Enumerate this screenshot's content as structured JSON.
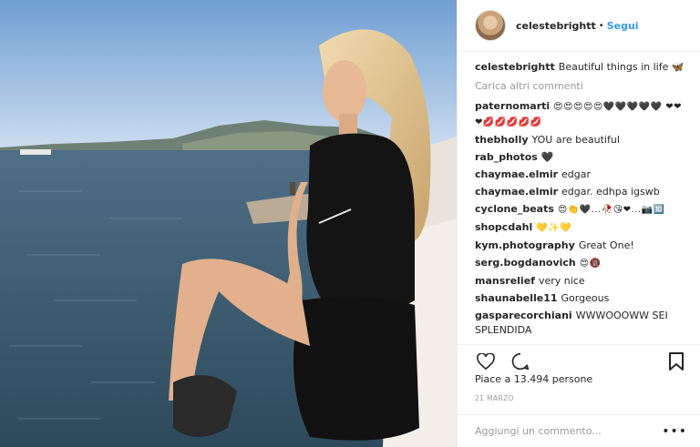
{
  "post": {
    "username": "celestebrightt",
    "separator": "•",
    "follow_label": "Segui",
    "caption_user": "celestebrightt",
    "caption_text": "Beautiful things in life 🦋",
    "load_more": "Carica altri commenti",
    "likes": "Piace a 13.494 persone",
    "date": "21 MARZO",
    "add_comment_placeholder": "Aggiungi un commento...",
    "more_options": "•••"
  },
  "comments": [
    {
      "user": "paternomarti",
      "text": "😍😍😍😍😍🖤🖤🖤🖤🖤 ❤❤❤💋💋💋💋💋"
    },
    {
      "user": "thebholly",
      "text": "YOU are beautiful"
    },
    {
      "user": "rab_photos",
      "text": "🖤"
    },
    {
      "user": "chaymae.elmir",
      "text": "edgar"
    },
    {
      "user": "chaymae.elmir",
      "text": "edgar. edhpa igswb"
    },
    {
      "user": "cyclone_beats",
      "text": "😍👏🖤...🥀😘❤...📷🔟"
    },
    {
      "user": "shopcdahl",
      "text": "💛✨💛"
    },
    {
      "user": "kym.photography",
      "text": "Great One!"
    },
    {
      "user": "serg.bogdanovich",
      "text": "😍🔞"
    },
    {
      "user": "mansrelief",
      "text": "very nice"
    },
    {
      "user": "shaunabelle11",
      "text": "Gorgeous"
    },
    {
      "user": "gasparecorchiani",
      "text": "WWWOOOWW SEI SPLENDIDA"
    }
  ],
  "icons": {
    "like": "heart-icon",
    "comment": "comment-icon",
    "save": "bookmark-icon",
    "avatar": "avatar"
  },
  "colors": {
    "link_blue": "#3897f0",
    "text": "#262626",
    "muted": "#999999",
    "border": "#efefef"
  }
}
